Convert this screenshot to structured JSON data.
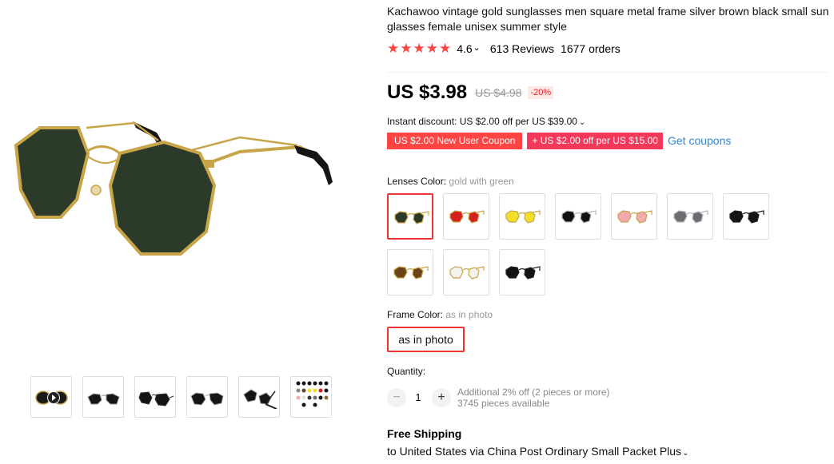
{
  "product": {
    "title": "Kachawoo vintage gold sunglasses men square metal frame silver brown black small sun glasses female unisex summer style",
    "stars": "★★★★★",
    "rating": "4.6",
    "reviews": "613 Reviews",
    "orders": "1677 orders"
  },
  "price": {
    "current": "US $3.98",
    "original": "US $4.98",
    "discount": "-20%"
  },
  "instant_discount": "Instant discount: US $2.00 off per US $39.00",
  "coupons": {
    "new_user": "US $2.00 New User Coupon",
    "off": "+ US $2.00 off per US $15.00",
    "get": "Get coupons"
  },
  "lens": {
    "label": "Lenses Color:",
    "selected": "gold with green",
    "options": [
      {
        "lens": "#2c3a2a",
        "frame": "#c9a54a"
      },
      {
        "lens": "#d42020",
        "frame": "#c9a54a"
      },
      {
        "lens": "#f2e028",
        "frame": "#c9a54a"
      },
      {
        "lens": "#111111",
        "frame": "#b8b8b8"
      },
      {
        "lens": "#f0aab0",
        "frame": "#c9a54a"
      },
      {
        "lens": "#6a6e72",
        "frame": "#b8b8b8"
      },
      {
        "lens": "#151515",
        "frame": "#222222"
      },
      {
        "lens": "#6b4318",
        "frame": "#c9a54a"
      },
      {
        "lens": "#f4f2ee",
        "frame": "#c9a54a"
      },
      {
        "lens": "#121212",
        "frame": "#222222"
      }
    ]
  },
  "frame": {
    "label": "Frame Color:",
    "selected": "as in photo",
    "option": "as in photo"
  },
  "quantity": {
    "label": "Quantity:",
    "value": "1",
    "minus": "−",
    "plus": "+",
    "additional": "Additional 2% off (2 pieces or more)",
    "available": "3745 pieces available"
  },
  "shipping": {
    "title": "Free Shipping",
    "detail": "to United States via China Post Ordinary Small Packet Plus"
  },
  "colors": {
    "accent": "#ee3333",
    "link": "#2f85d6",
    "gold": "#c9a54a"
  }
}
